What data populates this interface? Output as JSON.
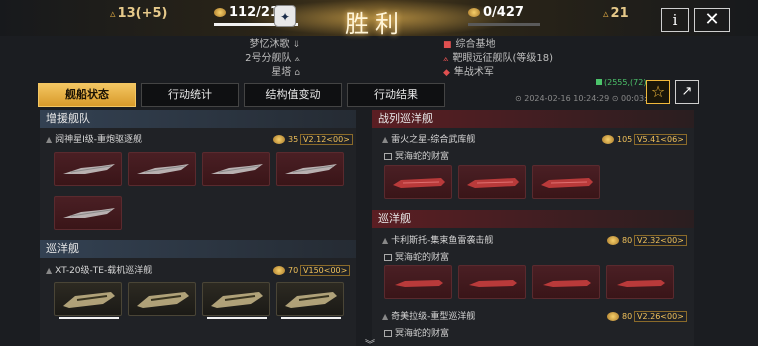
{
  "header": {
    "left_stat": "13(+5)",
    "score_left": "112/217",
    "title": "胜利",
    "score_right": "0/427",
    "right_stat": "21",
    "info_label": "i",
    "close_label": "✕",
    "emblem": "✦"
  },
  "subinfo": {
    "left": [
      "梦忆沐歌",
      "2号分舰队",
      "星塔"
    ],
    "right": [
      "综合基地",
      "靶眼远征舰队(等级18)",
      "隼战术军"
    ]
  },
  "tabs": [
    "舰船状态",
    "行动统计",
    "结构值变动",
    "行动结果"
  ],
  "coord": "(2555,(72)",
  "time": "⊙ 2024-02-16 10:24:29  ⊙ 00:03:11",
  "left_panel": {
    "sections": [
      {
        "title": "增援舰队",
        "ships": [
          {
            "name": "阋神星I级-重炮驱逐舰",
            "cost": "35",
            "version": "V2.12<00>"
          }
        ]
      },
      {
        "title": "巡洋舰",
        "ships": [
          {
            "name": "XT-20级-TE-载机巡洋舰",
            "cost": "70",
            "version": "V150<00>"
          }
        ]
      }
    ]
  },
  "right_panel": {
    "sections": [
      {
        "title": "战列巡洋舰",
        "ships": [
          {
            "name": "雷火之星-综合武库舰",
            "cost": "105",
            "version": "V5.41<06>",
            "sub": "冥海蛇的财富"
          }
        ]
      },
      {
        "title": "巡洋舰",
        "ships": [
          {
            "name": "卡利斯托-集束鱼雷袭击舰",
            "cost": "80",
            "version": "V2.32<00>",
            "sub": "冥海蛇的财富"
          },
          {
            "name": "奇美拉级-重型巡洋舰",
            "cost": "80",
            "version": "V2.26<00>",
            "sub": "冥海蛇的财富"
          }
        ]
      }
    ]
  },
  "colors": {
    "accent": "#f3c662",
    "enemy_red": "#5b1e23",
    "ally_blue": "#334152"
  },
  "bottom_arrow": "︾"
}
